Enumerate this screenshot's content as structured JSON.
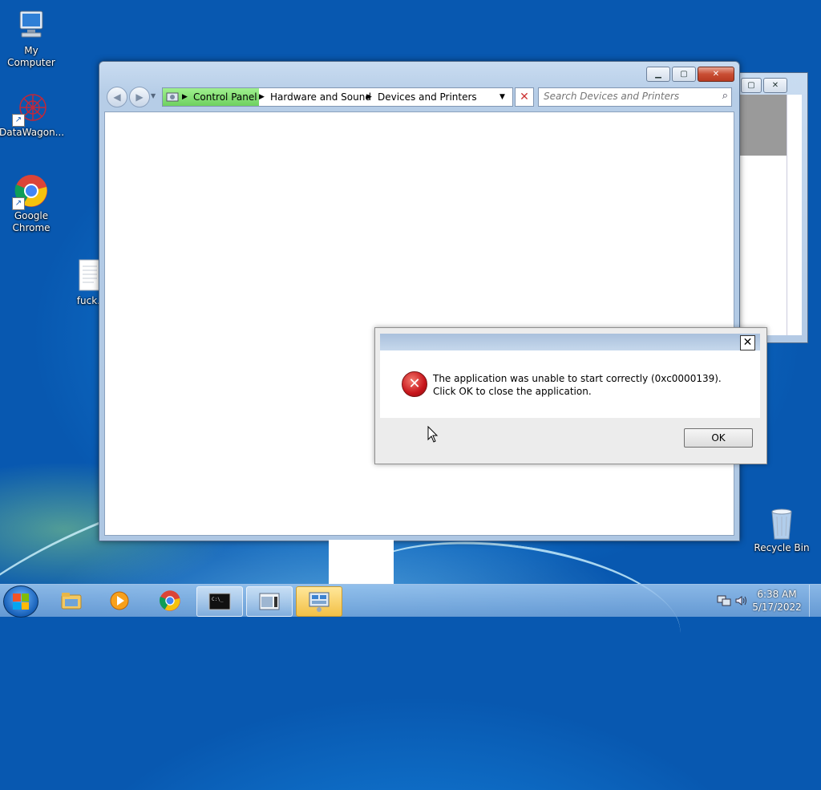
{
  "desktop": {
    "icons": [
      {
        "label": "My Computer"
      },
      {
        "label": "DataWagon..."
      },
      {
        "label": "Google Chrome"
      },
      {
        "label": "fuck."
      },
      {
        "label": "Recycle Bin"
      }
    ]
  },
  "explorer": {
    "breadcrumb": [
      "Control Panel",
      "Hardware and Sound",
      "Devices and Printers"
    ],
    "search_placeholder": "Search Devices and Printers",
    "caption_buttons": [
      "minimize",
      "maximize",
      "close"
    ]
  },
  "error_dialog": {
    "message": "The application was unable to start correctly (0xc0000139). Click OK to close the application.",
    "ok_label": "OK",
    "close_glyph": "✕"
  },
  "taskbar": {
    "apps": [
      {
        "icon": "explorer-icon"
      },
      {
        "icon": "media-player-icon"
      },
      {
        "icon": "chrome-icon"
      },
      {
        "icon": "cmd-icon",
        "active": true
      },
      {
        "icon": "window-icon",
        "active": true
      },
      {
        "icon": "control-panel-icon",
        "active": true,
        "highlighted": true
      }
    ],
    "time": "6:38 AM",
    "date": "5/17/2022"
  },
  "colors": {
    "error_red": "#c7151b",
    "crumb_green": "#6fd160",
    "dialog_title": "#a9c0dc"
  }
}
